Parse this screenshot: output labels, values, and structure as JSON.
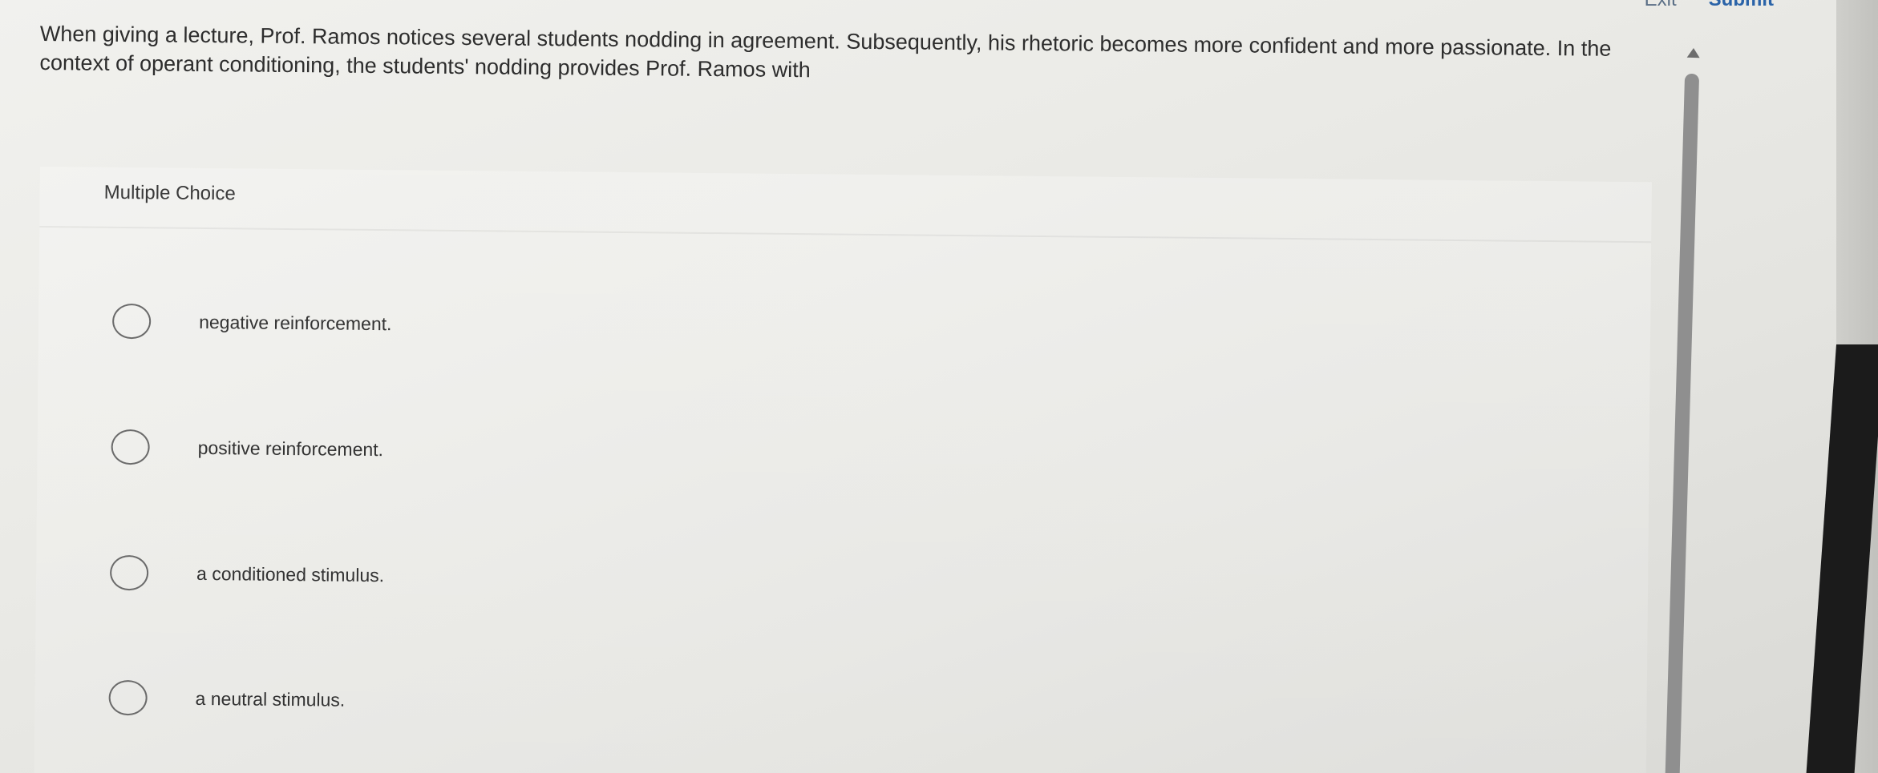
{
  "header": {
    "exit_label": "Exit",
    "submit_label": "Submit"
  },
  "question": {
    "text": "When giving a lecture, Prof. Ramos notices several students nodding in agreement. Subsequently, his rhetoric becomes more confident and more passionate. In the context of operant conditioning, the students' nodding provides Prof. Ramos with"
  },
  "choices": {
    "label": "Multiple Choice",
    "options": [
      {
        "text": "negative reinforcement."
      },
      {
        "text": "positive reinforcement."
      },
      {
        "text": "a conditioned stimulus."
      },
      {
        "text": "a neutral stimulus."
      }
    ]
  },
  "icons": {
    "scroll_up": "triangle-up-icon",
    "radio": "radio-unchecked-icon"
  }
}
